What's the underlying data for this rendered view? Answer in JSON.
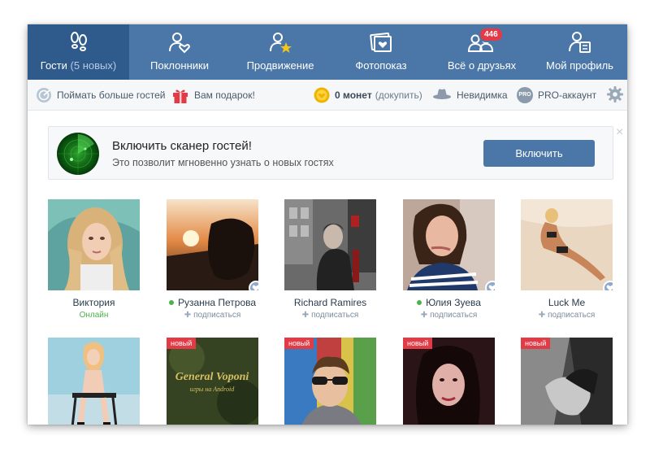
{
  "nav": {
    "items": [
      {
        "label": "Гости",
        "sub": "(5 новых)",
        "icon": "footprints-icon"
      },
      {
        "label": "Поклонники",
        "icon": "user-heart-icon"
      },
      {
        "label": "Продвижение",
        "icon": "user-star-icon"
      },
      {
        "label": "Фотопоказ",
        "icon": "photo-heart-icon"
      },
      {
        "label": "Всё о друзьях",
        "icon": "friends-icon",
        "badge": "446"
      },
      {
        "label": "Мой профиль",
        "icon": "user-card-icon"
      }
    ]
  },
  "toolbar": {
    "catch_guests": "Поймать больше гостей",
    "gift": "Вам подарок!",
    "coins_count": "0 монет",
    "coins_topup": "(докупить)",
    "invisible": "Невидимка",
    "pro_badge": "PRO",
    "pro_account": "PRO-аккаунт"
  },
  "banner": {
    "title": "Включить сканер гостей!",
    "subtitle": "Это позволит мгновенно узнать о новых гостях",
    "button": "Включить",
    "close": "×"
  },
  "guests": {
    "new_label": "новый",
    "subscribe_label": "подписаться",
    "row1": [
      {
        "name": "Виктория",
        "status": "Онлайн"
      },
      {
        "name": "Рузанна Петрова",
        "online": true
      },
      {
        "name": "Richard Ramires"
      },
      {
        "name": "Юлия Зуева",
        "online": true
      },
      {
        "name": "Luck Me"
      }
    ],
    "row2_overlay_text_1": "General Voponi",
    "row2_overlay_text_2": "игры на Android"
  },
  "colors": {
    "nav_bg": "#4a76a8",
    "nav_active": "#2f5b8c",
    "badge": "#e23b46",
    "online": "#4bb34b"
  }
}
